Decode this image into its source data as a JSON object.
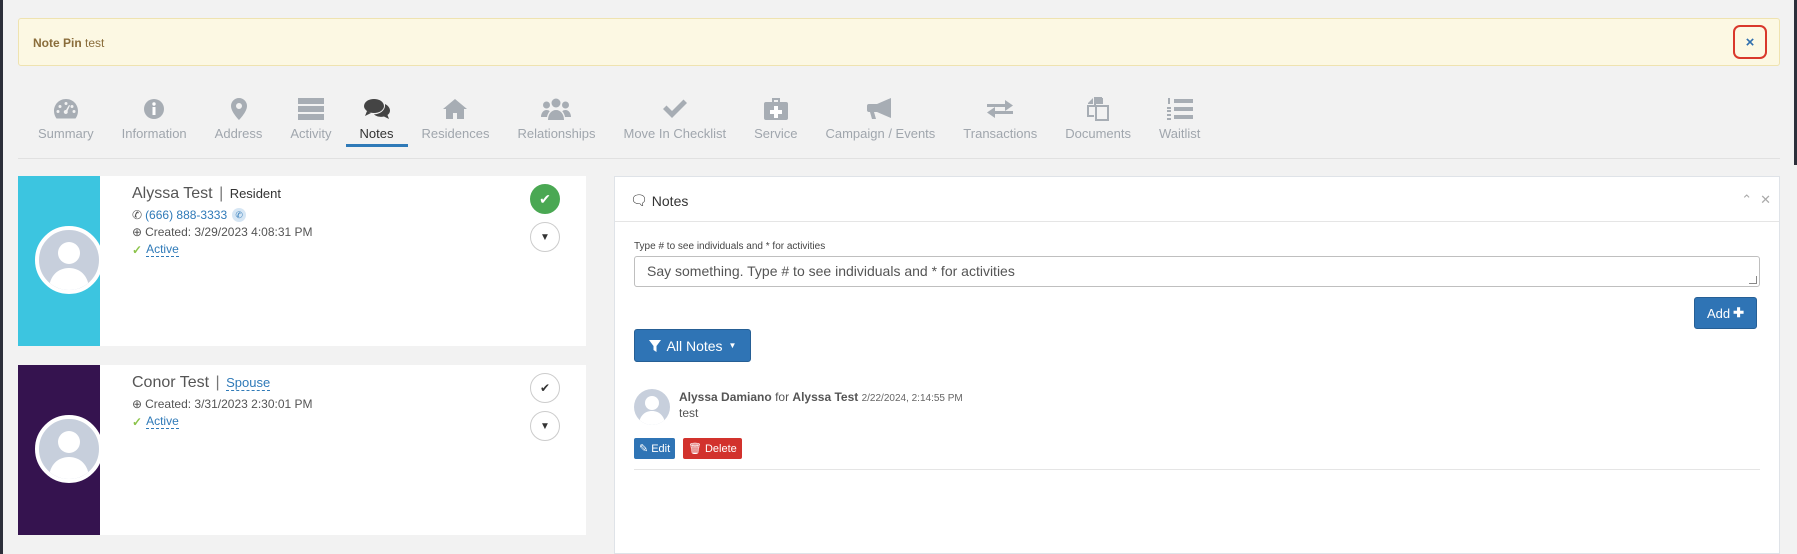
{
  "pin": {
    "title": "Note Pin",
    "text": "test",
    "close_icon": "×"
  },
  "tabs": [
    {
      "label": "Summary",
      "icon": "dashboard-icon"
    },
    {
      "label": "Information",
      "icon": "info-icon"
    },
    {
      "label": "Address",
      "icon": "map-pin-icon"
    },
    {
      "label": "Activity",
      "icon": "server-icon"
    },
    {
      "label": "Notes",
      "icon": "comments-icon",
      "active": true
    },
    {
      "label": "Residences",
      "icon": "home-icon"
    },
    {
      "label": "Relationships",
      "icon": "users-icon"
    },
    {
      "label": "Move In Checklist",
      "icon": "check-icon"
    },
    {
      "label": "Service",
      "icon": "medkit-icon"
    },
    {
      "label": "Campaign / Events",
      "icon": "bullhorn-icon"
    },
    {
      "label": "Transactions",
      "icon": "exchange-icon"
    },
    {
      "label": "Documents",
      "icon": "copy-icon"
    },
    {
      "label": "Waitlist",
      "icon": "list-ol-icon"
    }
  ],
  "people": [
    {
      "name": "Alyssa Test",
      "role": "Resident",
      "phone": "(666) 888-3333",
      "created": "Created: 3/29/2023 4:08:31 PM",
      "status": "Active",
      "color": "#3cc5e0"
    },
    {
      "name": "Conor Test",
      "role": "Spouse",
      "created": "Created: 3/31/2023 2:30:01 PM",
      "status": "Active",
      "color": "#35134f"
    }
  ],
  "notes_panel": {
    "title": "Notes",
    "hint": "Type # to see individuals and * for activities",
    "placeholder": "Say something. Type # to see individuals and * for activities",
    "add_label": "Add",
    "filter_label": "All Notes",
    "note": {
      "author": "Alyssa Damiano",
      "for_word": "for",
      "subject": "Alyssa Test",
      "date": "2/22/2024, 2:14:55 PM",
      "body": "test",
      "edit_label": "Edit",
      "delete_label": "Delete"
    }
  },
  "colors": {
    "accent": "#2f74b5",
    "danger": "#d2322d",
    "success": "#4aa853",
    "pin_bg": "#fcf8e3"
  }
}
